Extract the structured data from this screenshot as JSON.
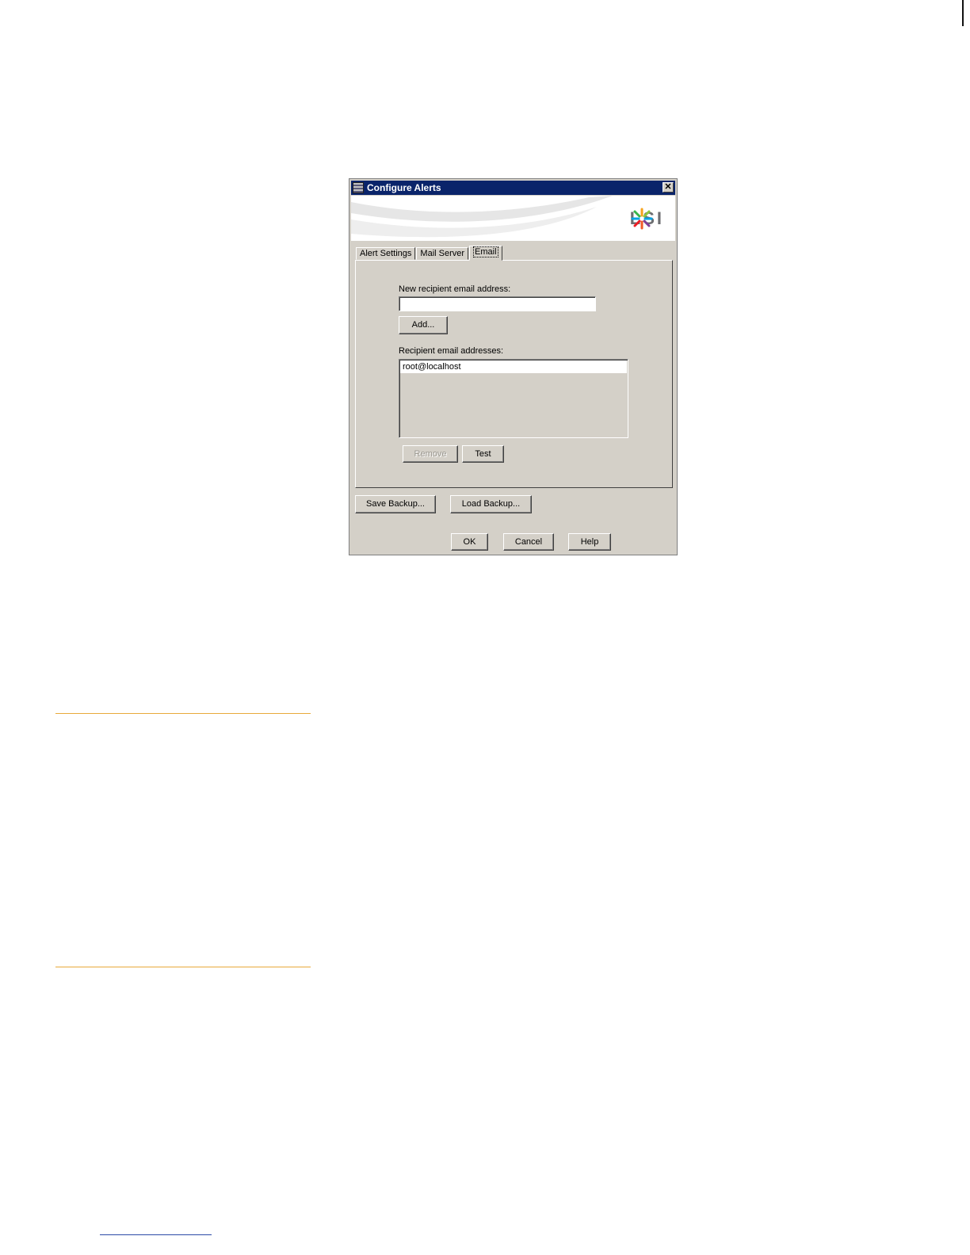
{
  "dialog": {
    "title": "Configure Alerts",
    "close_symbol": "✕",
    "logo_text": "LSI",
    "tabs": [
      {
        "label": "Alert Settings",
        "active": false
      },
      {
        "label": "Mail Server",
        "active": false
      },
      {
        "label": "Email",
        "active": true
      }
    ],
    "email_tab": {
      "new_recipient_label": "New recipient email address:",
      "new_recipient_value": "",
      "add_label": "Add...",
      "recipients_label": "Recipient email addresses:",
      "recipients": [
        "root@localhost"
      ],
      "remove_label": "Remove",
      "test_label": "Test"
    },
    "save_backup_label": "Save Backup...",
    "load_backup_label": "Load Backup...",
    "ok_label": "OK",
    "cancel_label": "Cancel",
    "help_label": "Help"
  },
  "colors": {
    "titlebar": "#0a246a",
    "dialog_bg": "#d4d0c8",
    "rule": "#e9a93b"
  },
  "icons": {
    "title_icon": "app-icon",
    "close": "close-icon",
    "logo": "lsi-logo-icon"
  }
}
